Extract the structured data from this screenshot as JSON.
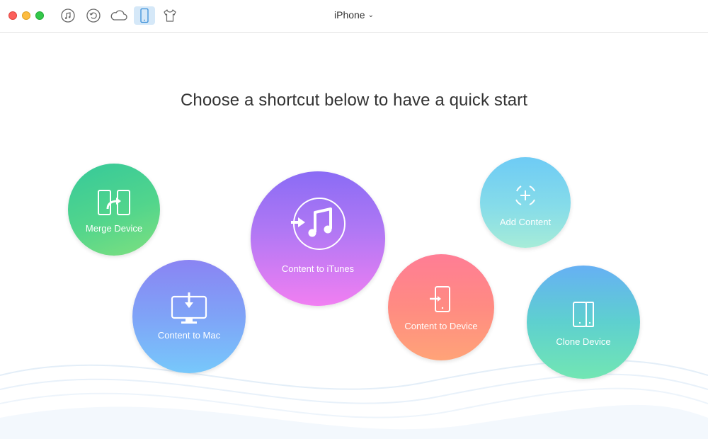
{
  "window": {
    "device_name": "iPhone",
    "toolbar_icons": [
      "itunes-library-icon",
      "backup-restore-icon",
      "icloud-icon",
      "device-icon",
      "shirt-icon"
    ],
    "active_tool": "device-icon"
  },
  "main": {
    "headline": "Choose a shortcut below to have a quick start"
  },
  "shortcuts": {
    "merge_device": "Merge Device",
    "content_to_mac": "Content to Mac",
    "content_to_itunes": "Content to iTunes",
    "content_to_device": "Content to Device",
    "add_content": "Add Content",
    "clone_device": "Clone Device"
  }
}
